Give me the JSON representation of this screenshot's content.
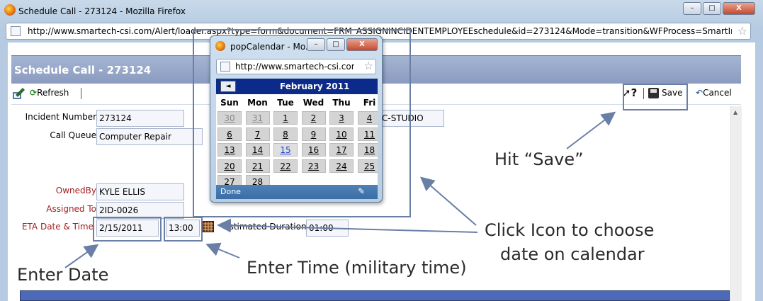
{
  "window": {
    "title": "Schedule Call - 273124 - Mozilla Firefox",
    "url": "http://www.smartech-csi.com/Alert/loader.aspx?type=form&document=FRM_ASSIGNINCIDENTEMPLOYEEschedule&id=273124&Mode=transition&WFProcess=SmartIncident&action=Scl",
    "minimize": "–",
    "maximize": "□",
    "close": "X"
  },
  "page": {
    "title": "Schedule Call - 273124"
  },
  "toolbar": {
    "refresh": "Refresh",
    "help": "?",
    "save": "Save",
    "cancel": "Cancel"
  },
  "form": {
    "incident_number_label": "Incident Number",
    "incident_number": "273124",
    "call_queue_label": "Call Queue",
    "call_queue": "Computer Repair",
    "partial_field": "C-STUDIO",
    "owned_by_label": "OwnedBy",
    "owned_by": "KYLE ELLIS",
    "assigned_to_label": "Assigned To",
    "assigned_to": "2ID-0026",
    "eta_label": "ETA Date & Time",
    "eta_date": "2/15/2011",
    "eta_time": "13:00",
    "est_duration_label": "Estimated Duration",
    "est_duration": "01:00"
  },
  "calendar": {
    "title": "popCalendar - Mo...",
    "url": "http://www.smartech-csi.com/",
    "month": "February 2011",
    "prev": "◄",
    "weekdays": [
      "Sun",
      "Mon",
      "Tue",
      "Wed",
      "Thu",
      "Fri"
    ],
    "rows": [
      [
        "30",
        "31",
        "1",
        "2",
        "3",
        "4"
      ],
      [
        "6",
        "7",
        "8",
        "9",
        "10",
        "11"
      ],
      [
        "13",
        "14",
        "15",
        "16",
        "17",
        "18"
      ],
      [
        "20",
        "21",
        "22",
        "23",
        "24",
        "25"
      ],
      [
        "27",
        "28",
        "",
        "",
        "",
        ""
      ]
    ],
    "dimmed": [
      "30",
      "31"
    ],
    "today": "15",
    "status": "Done"
  },
  "annotations": {
    "hit_save": "Hit “Save”",
    "click_icon_line1": "Click Icon to choose",
    "click_icon_line2": "date on calendar",
    "enter_date": "Enter Date",
    "enter_time": "Enter Time (military time)"
  },
  "colors": {
    "title_bar": "#8a9bc0",
    "calendar_header": "#0c2a8a",
    "label_red": "#a32020",
    "annotation": "#6a7fa6"
  }
}
